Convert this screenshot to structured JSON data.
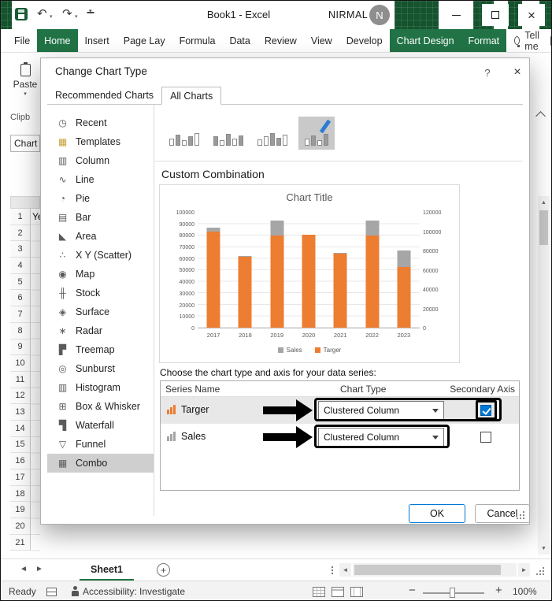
{
  "titlebar": {
    "title": "Book1 - Excel",
    "user_name": "NIRMAL",
    "avatar_initial": "N"
  },
  "icons": {
    "close": "×",
    "undo": "↶",
    "redo": "↷",
    "caret_down": "▾",
    "scroll_up": "▲",
    "scroll_down": "▼",
    "scroll_left": "◄",
    "scroll_right": "►",
    "add_sheet": "+",
    "zoom_minus": "−",
    "zoom_plus": "+"
  },
  "colors": {
    "excel_green": "#217346",
    "checkbox_blue": "#0078D7",
    "annotation_black": "#000000"
  },
  "ribbon": {
    "tabs": [
      {
        "label": "File",
        "active": false
      },
      {
        "label": "Home",
        "active": true
      },
      {
        "label": "Insert",
        "active": false
      },
      {
        "label": "Page Lay",
        "active": false
      },
      {
        "label": "Formula",
        "active": false
      },
      {
        "label": "Data",
        "active": false
      },
      {
        "label": "Review",
        "active": false
      },
      {
        "label": "View",
        "active": false
      },
      {
        "label": "Develop",
        "active": false
      },
      {
        "label": "Chart Design",
        "active": true
      },
      {
        "label": "Format",
        "active": true
      }
    ],
    "tell_me_label": "Tell me"
  },
  "worksheet": {
    "paste_label": "Paste",
    "clipboard_group_label": "Clipb",
    "name_box_value": "Chart",
    "cell_a1_value": "Ye",
    "row_numbers": [
      "1",
      "2",
      "3",
      "4",
      "5",
      "6",
      "7",
      "8",
      "9",
      "10",
      "11",
      "12",
      "13",
      "14",
      "15",
      "16",
      "17",
      "18",
      "19",
      "20",
      "21"
    ],
    "sheet_tab": "Sheet1"
  },
  "status_bar": {
    "ready_label": "Ready",
    "accessibility_label": "Accessibility: Investigate",
    "zoom_level": "100%"
  },
  "dialog": {
    "title": "Change Chart Type",
    "help_label": "?",
    "tabs": [
      {
        "label": "Recommended Charts",
        "active": false
      },
      {
        "label": "All Charts",
        "active": true
      }
    ],
    "categories": [
      {
        "label": "Recent",
        "icon": "◷",
        "icon_name": "recent-icon"
      },
      {
        "label": "Templates",
        "icon": "▦",
        "icon_name": "templates-icon",
        "icon_color": "#C8A238"
      },
      {
        "label": "Column",
        "icon": "▥",
        "icon_name": "column-chart-icon"
      },
      {
        "label": "Line",
        "icon": "∿",
        "icon_name": "line-chart-icon"
      },
      {
        "label": "Pie",
        "icon": "◔",
        "icon_name": "pie-chart-icon"
      },
      {
        "label": "Bar",
        "icon": "▤",
        "icon_name": "bar-chart-icon"
      },
      {
        "label": "Area",
        "icon": "◣",
        "icon_name": "area-chart-icon"
      },
      {
        "label": "X Y (Scatter)",
        "icon": "∴",
        "icon_name": "scatter-chart-icon"
      },
      {
        "label": "Map",
        "icon": "◉",
        "icon_name": "map-chart-icon"
      },
      {
        "label": "Stock",
        "icon": "╫",
        "icon_name": "stock-chart-icon"
      },
      {
        "label": "Surface",
        "icon": "◈",
        "icon_name": "surface-chart-icon"
      },
      {
        "label": "Radar",
        "icon": "∗",
        "icon_name": "radar-chart-icon"
      },
      {
        "label": "Treemap",
        "icon": "▛",
        "icon_name": "treemap-chart-icon"
      },
      {
        "label": "Sunburst",
        "icon": "◎",
        "icon_name": "sunburst-chart-icon"
      },
      {
        "label": "Histogram",
        "icon": "▥",
        "icon_name": "histogram-chart-icon"
      },
      {
        "label": "Box & Whisker",
        "icon": "⊞",
        "icon_name": "box-whisker-chart-icon"
      },
      {
        "label": "Waterfall",
        "icon": "▜",
        "icon_name": "waterfall-chart-icon"
      },
      {
        "label": "Funnel",
        "icon": "▽",
        "icon_name": "funnel-chart-icon"
      },
      {
        "label": "Combo",
        "icon": "▦",
        "icon_name": "combo-chart-icon",
        "selected": true
      }
    ],
    "subtype_buttons": [
      {
        "name": "clustered-column-line"
      },
      {
        "name": "clustered-column-line-secondary-axis"
      },
      {
        "name": "stacked-area-clustered-column"
      },
      {
        "name": "custom-combination",
        "selected": true
      }
    ],
    "section_title": "Custom Combination",
    "choose_label": "Choose the chart type and axis for your data series:",
    "series_table": {
      "headers": [
        "Series Name",
        "Chart Type",
        "Secondary Axis"
      ],
      "rows": [
        {
          "name": "Targer",
          "swatch_color": "#ED7D31",
          "chart_type": "Clustered Column",
          "secondary_axis_checked": true,
          "highlighted": true,
          "arrow_annotation": true,
          "box_annotation": "dropdown-and-checkbox"
        },
        {
          "name": "Sales",
          "swatch_color": "#A5A5A5",
          "chart_type": "Clustered Column",
          "secondary_axis_checked": false,
          "highlighted": false,
          "arrow_annotation": true,
          "box_annotation": "dropdown"
        }
      ]
    },
    "ok_label": "OK",
    "cancel_label": "Cancel"
  },
  "chart_data": {
    "type": "bar",
    "title": "Chart Title",
    "categories": [
      "2017",
      "2018",
      "2019",
      "2020",
      "2021",
      "2022",
      "2023"
    ],
    "series": [
      {
        "name": "Sales",
        "color": "#A6A6A6",
        "axis": "primary",
        "values": [
          87000,
          62000,
          93000,
          81000,
          65000,
          93000,
          67000
        ]
      },
      {
        "name": "Targer",
        "color": "#ED7D31",
        "axis": "secondary",
        "values": [
          100000,
          74000,
          96000,
          97000,
          77000,
          96000,
          63000
        ]
      }
    ],
    "primary_axis": {
      "min": 0,
      "max": 100000,
      "step": 10000
    },
    "secondary_axis": {
      "min": 0,
      "max": 120000,
      "step": 20000
    },
    "legend_position": "bottom",
    "grid": true
  }
}
